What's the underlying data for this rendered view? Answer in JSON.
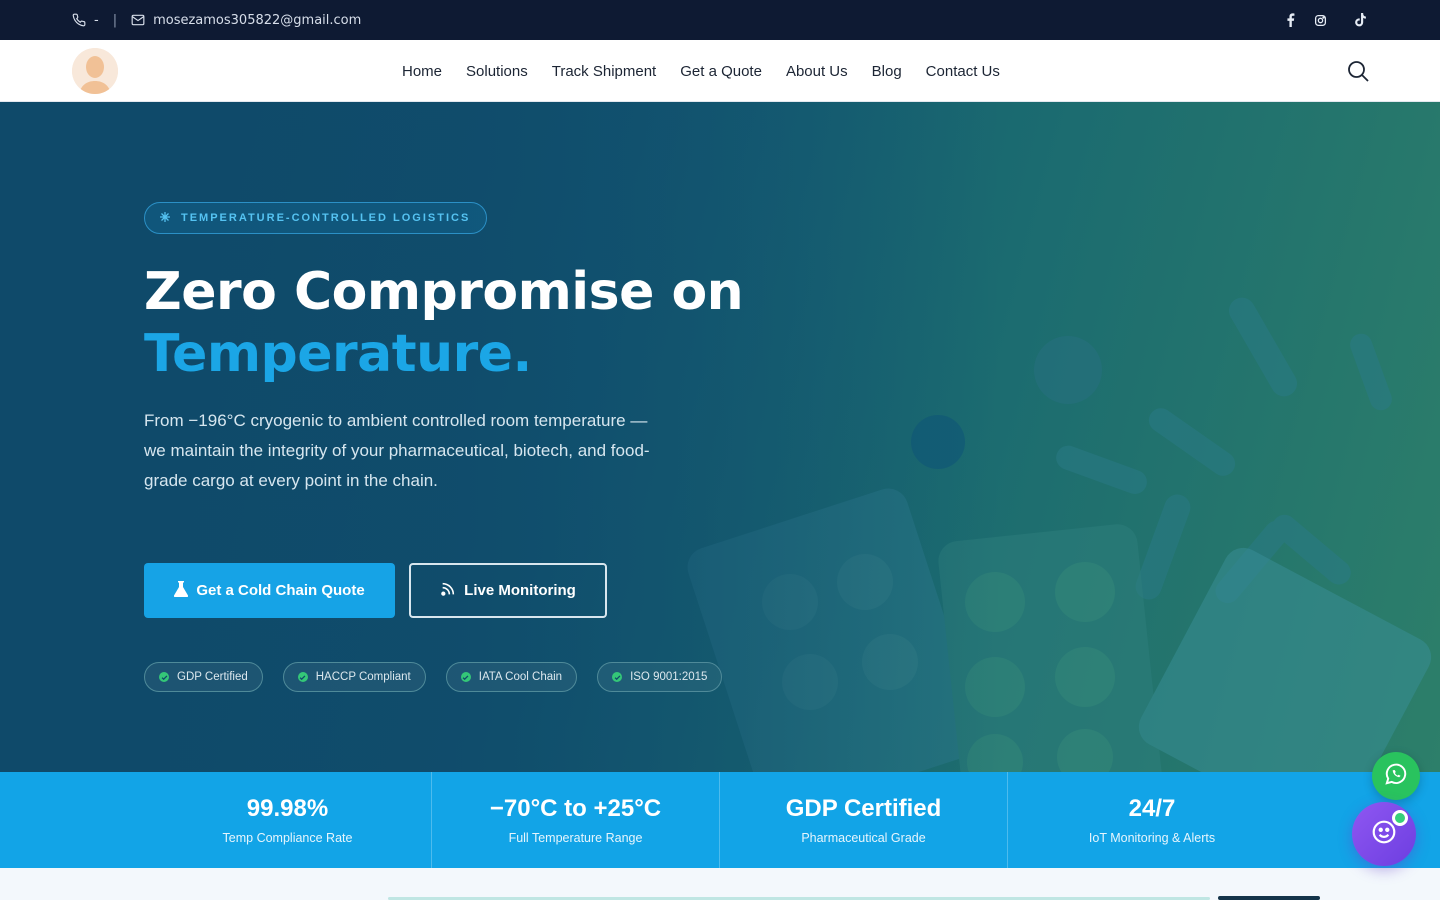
{
  "topbar": {
    "phone": "-",
    "separator": "|",
    "email": "mosezamos305822@gmail.com",
    "social": [
      "facebook-icon",
      "instagram-icon",
      "tiktok-icon"
    ]
  },
  "nav": {
    "links": [
      "Home",
      "Solutions",
      "Track Shipment",
      "Get a Quote",
      "About Us",
      "Blog",
      "Contact Us"
    ]
  },
  "hero": {
    "eyebrow": "TEMPERATURE-CONTROLLED LOGISTICS",
    "title_line1": "Zero Compromise on",
    "title_line2": "Temperature.",
    "lede": "From −196°C cryogenic to ambient controlled room temperature — we maintain the integrity of your pharmaceutical, biotech, and food-grade cargo at every point in the chain.",
    "primary_cta": "Get a Cold Chain Quote",
    "secondary_cta": "Live Monitoring",
    "badges": [
      "GDP Certified",
      "HACCP Compliant",
      "IATA Cool Chain",
      "ISO 9001:2015"
    ]
  },
  "stats": [
    {
      "value": "99.98%",
      "label": "Temp Compliance Rate"
    },
    {
      "value": "−70°C to +25°C",
      "label": "Full Temperature Range"
    },
    {
      "value": "GDP Certified",
      "label": "Pharmaceutical Grade"
    },
    {
      "value": "24/7",
      "label": "IoT Monitoring & Alerts"
    }
  ],
  "colors": {
    "topbar": "#0e1a33",
    "accent": "#16a3e6",
    "stats_band": "#12a4e7",
    "whatsapp": "#29c35e",
    "chatbot": "#7b48ea"
  }
}
